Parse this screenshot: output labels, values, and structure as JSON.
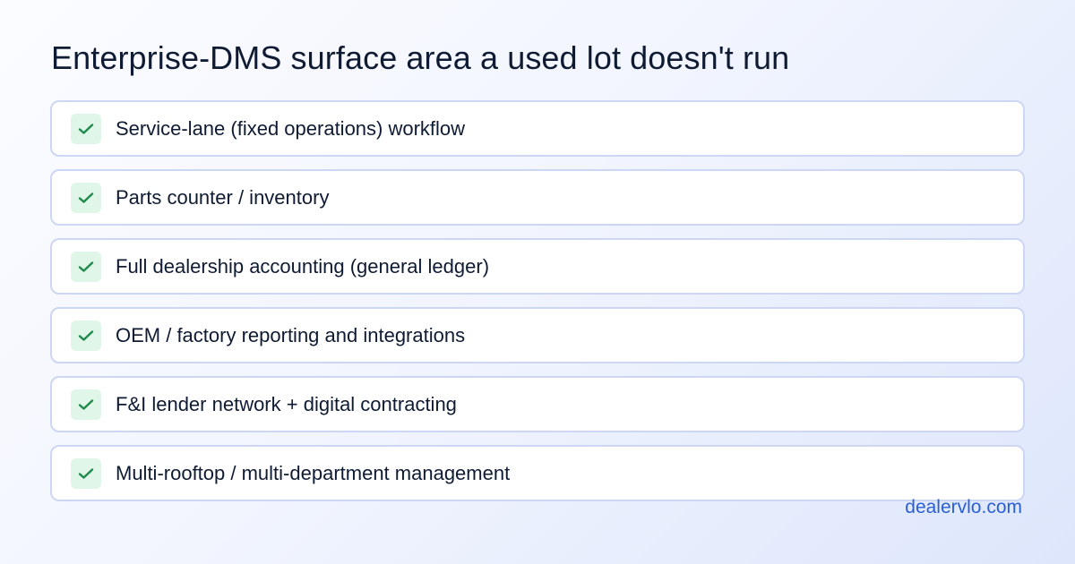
{
  "title": "Enterprise-DMS surface area a used lot doesn't run",
  "items": [
    {
      "label": "Service-lane (fixed operations) workflow",
      "icon": "check-icon"
    },
    {
      "label": "Parts counter / inventory",
      "icon": "check-icon"
    },
    {
      "label": "Full dealership accounting (general ledger)",
      "icon": "check-icon"
    },
    {
      "label": "OEM / factory reporting and integrations",
      "icon": "check-icon"
    },
    {
      "label": "F&I lender network + digital contracting",
      "icon": "check-icon"
    },
    {
      "label": "Multi-rooftop / multi-department management",
      "icon": "check-icon"
    }
  ],
  "brand": "dealervlo.com",
  "colors": {
    "check_bg": "#dff6e8",
    "check_mark": "#1f8a4c",
    "card_border": "#cdd6f3",
    "brand": "#2b5fd4",
    "text": "#0f1b33"
  }
}
